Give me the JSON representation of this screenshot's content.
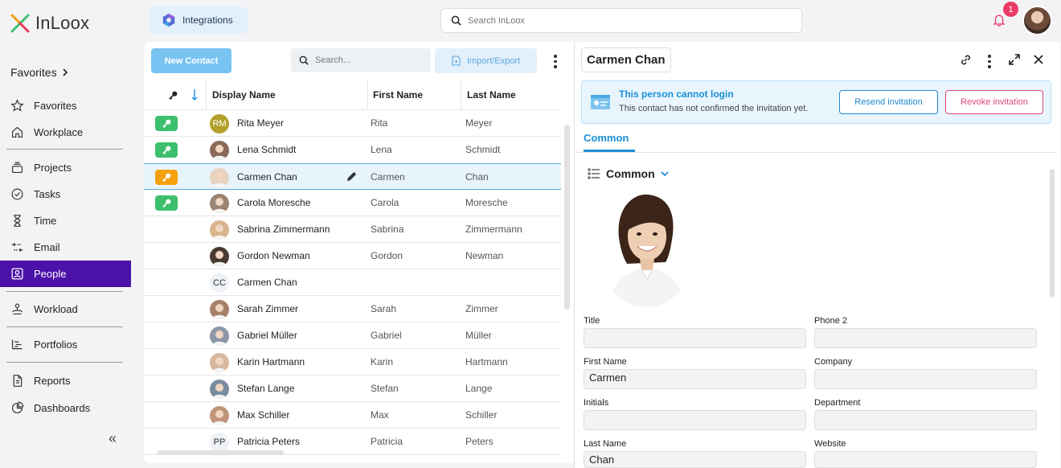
{
  "app": {
    "name": "InLoox"
  },
  "sidebar": {
    "favorites_header": "Favorites",
    "items": [
      {
        "label": "Favorites",
        "icon": "star-icon"
      },
      {
        "label": "Workplace",
        "icon": "home-icon"
      },
      {
        "label": "Projects",
        "icon": "projects-icon"
      },
      {
        "label": "Tasks",
        "icon": "check-circle-icon"
      },
      {
        "label": "Time",
        "icon": "hourglass-icon"
      },
      {
        "label": "Email",
        "icon": "email-icon"
      },
      {
        "label": "People",
        "icon": "people-icon"
      },
      {
        "label": "Workload",
        "icon": "workload-icon"
      },
      {
        "label": "Portfolios",
        "icon": "portfolios-icon"
      },
      {
        "label": "Reports",
        "icon": "reports-icon"
      },
      {
        "label": "Dashboards",
        "icon": "dashboards-icon"
      }
    ],
    "collapse": "«"
  },
  "topbar": {
    "integrations_label": "Integrations",
    "search_placeholder": "Search InLoox",
    "notification_count": "1"
  },
  "list": {
    "new_contact_label": "New Contact",
    "search_placeholder": "Search...",
    "import_export_label": "Import/Export",
    "columns": {
      "display_name": "Display Name",
      "first_name": "First Name",
      "last_name": "Last Name"
    },
    "rows": [
      {
        "display": "Rita Meyer",
        "first": "Rita",
        "last": "Meyer",
        "initials": "RM",
        "key": "green"
      },
      {
        "display": "Lena Schmidt",
        "first": "Lena",
        "last": "Schmidt",
        "initials": "",
        "key": "green"
      },
      {
        "display": "Carmen Chan",
        "first": "Carmen",
        "last": "Chan",
        "initials": "",
        "key": "orange"
      },
      {
        "display": "Carola Moresche",
        "first": "Carola",
        "last": "Moresche",
        "initials": "",
        "key": "green"
      },
      {
        "display": "Sabrina Zimmermann",
        "first": "Sabrina",
        "last": "Zimmermann",
        "initials": "",
        "key": ""
      },
      {
        "display": "Gordon Newman",
        "first": "Gordon",
        "last": "Newman",
        "initials": "",
        "key": ""
      },
      {
        "display": "Carmen Chan",
        "first": "",
        "last": "",
        "initials": "CC",
        "key": ""
      },
      {
        "display": "Sarah Zimmer",
        "first": "Sarah",
        "last": "Zimmer",
        "initials": "",
        "key": ""
      },
      {
        "display": "Gabriel Müller",
        "first": "Gabriel",
        "last": "Müller",
        "initials": "",
        "key": ""
      },
      {
        "display": "Karin Hartmann",
        "first": "Karin",
        "last": "Hartmann",
        "initials": "",
        "key": ""
      },
      {
        "display": "Stefan Lange",
        "first": "Stefan",
        "last": "Lange",
        "initials": "",
        "key": ""
      },
      {
        "display": "Max Schiller",
        "first": "Max",
        "last": "Schiller",
        "initials": "",
        "key": ""
      },
      {
        "display": "Patricia Peters",
        "first": "Patricia",
        "last": "Peters",
        "initials": "PP",
        "key": ""
      }
    ]
  },
  "detail": {
    "title": "Carmen Chan",
    "notice_title": "This person cannot login",
    "notice_text": "This contact has not confirmed the invitation yet.",
    "resend_label": "Resend invitation",
    "revoke_label": "Revoke invitation",
    "tab_label": "Common",
    "section_label": "Common",
    "fields": {
      "title_label": "Title",
      "title_value": "",
      "phone2_label": "Phone 2",
      "phone2_value": "",
      "first_name_label": "First Name",
      "first_name_value": "Carmen",
      "company_label": "Company",
      "company_value": "",
      "initials_label": "Initials",
      "initials_value": "",
      "department_label": "Department",
      "department_value": "",
      "last_name_label": "Last Name",
      "last_name_value": "Chan",
      "website_label": "Website",
      "website_value": ""
    }
  },
  "colors": {
    "accent_purple": "#4b11a8",
    "accent_blue": "#1b90d6",
    "key_green": "#3dbf6e",
    "key_orange": "#f5a10d",
    "danger": "#e04874"
  }
}
